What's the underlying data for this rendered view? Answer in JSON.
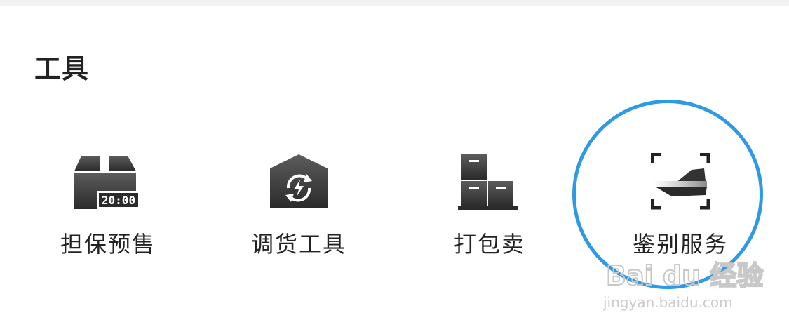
{
  "section": {
    "title": "工具"
  },
  "tools": [
    {
      "label": "担保预售",
      "icon": "presale-box-clock-icon",
      "clock_text": "20:00"
    },
    {
      "label": "调货工具",
      "icon": "warehouse-transfer-icon"
    },
    {
      "label": "打包卖",
      "icon": "stacked-boxes-icon"
    },
    {
      "label": "鉴别服务",
      "icon": "sneaker-scan-icon"
    }
  ],
  "annotation": {
    "circle_color": "#2d9ae6"
  },
  "watermark": {
    "brand": "Bai du 经验",
    "url": "jingyan.baidu.com"
  }
}
